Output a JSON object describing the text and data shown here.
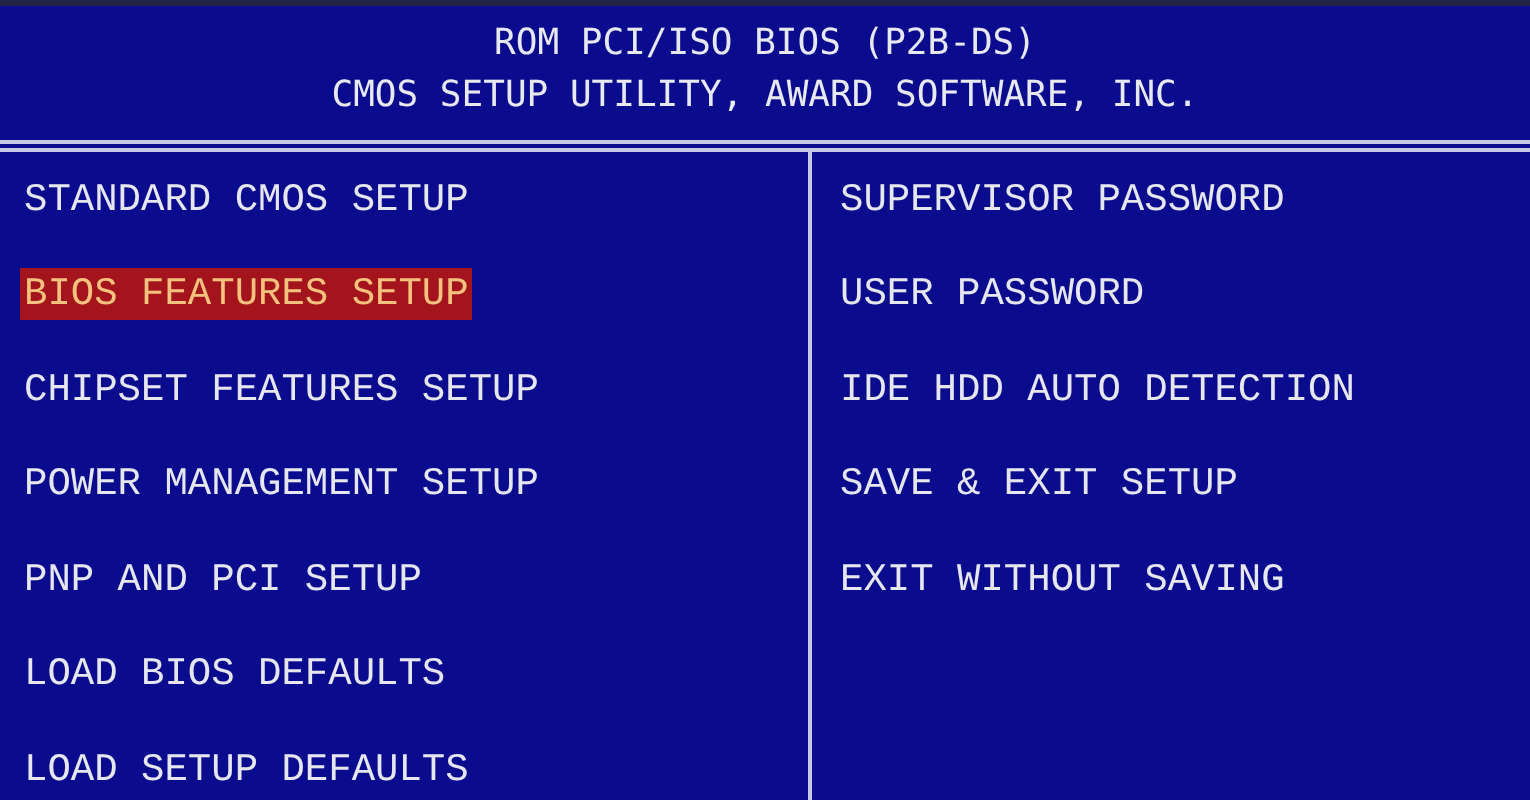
{
  "header": {
    "lines": [
      "ROM PCI/ISO BIOS (P2B-DS)",
      "CMOS SETUP UTILITY, AWARD SOFTWARE, INC."
    ]
  },
  "menu": {
    "columns": [
      {
        "items": [
          {
            "label": "STANDARD CMOS SETUP",
            "selected": false
          },
          {
            "label": "BIOS FEATURES SETUP",
            "selected": true
          },
          {
            "label": "CHIPSET FEATURES SETUP",
            "selected": false
          },
          {
            "label": "POWER MANAGEMENT SETUP",
            "selected": false
          },
          {
            "label": "PNP AND PCI SETUP",
            "selected": false
          },
          {
            "label": "LOAD BIOS DEFAULTS",
            "selected": false
          },
          {
            "label": "LOAD SETUP DEFAULTS",
            "selected": false
          }
        ]
      },
      {
        "items": [
          {
            "label": "SUPERVISOR PASSWORD",
            "selected": false
          },
          {
            "label": "USER PASSWORD",
            "selected": false
          },
          {
            "label": "IDE HDD AUTO DETECTION",
            "selected": false
          },
          {
            "label": "SAVE & EXIT SETUP",
            "selected": false
          },
          {
            "label": "EXIT WITHOUT SAVING",
            "selected": false
          }
        ]
      }
    ]
  }
}
